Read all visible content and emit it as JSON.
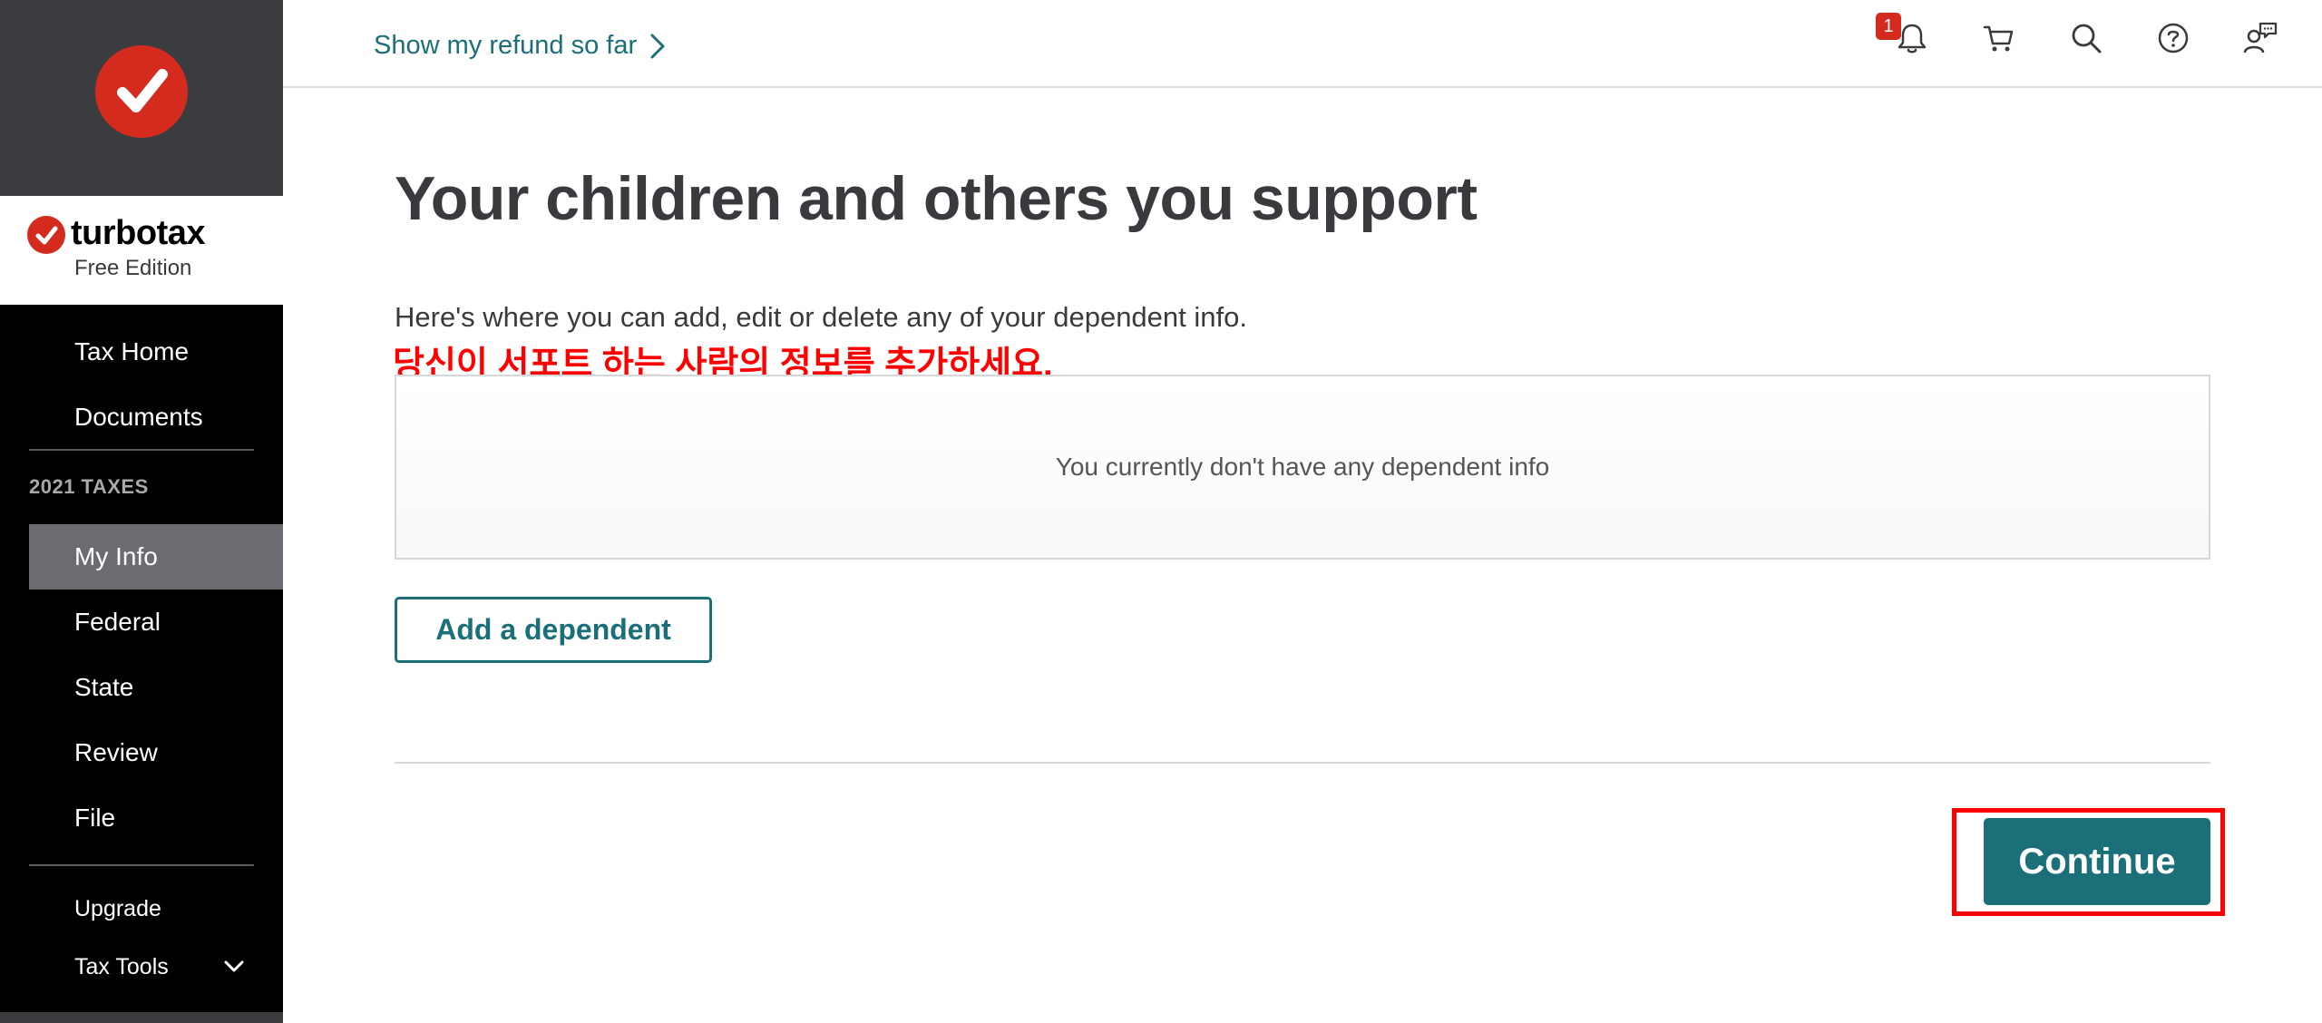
{
  "brand": {
    "name": "turbotax",
    "edition": "Free Edition"
  },
  "sidebar": {
    "items_top": [
      {
        "label": "Tax Home"
      },
      {
        "label": "Documents"
      }
    ],
    "section_label": "2021 TAXES",
    "items_taxes": [
      {
        "label": "My Info",
        "active": true
      },
      {
        "label": "Federal"
      },
      {
        "label": "State"
      },
      {
        "label": "Review"
      },
      {
        "label": "File"
      }
    ],
    "items_bottom": [
      {
        "label": "Upgrade"
      },
      {
        "label": "Tax Tools"
      }
    ]
  },
  "header": {
    "refund_link": "Show my refund so far",
    "notification_count": "1",
    "icons": [
      "bell-icon",
      "cart-icon",
      "search-icon",
      "help-icon",
      "chat-icon"
    ]
  },
  "main": {
    "title": "Your children and others you support",
    "intro": "Here's where you can add, edit or delete any of your dependent info.",
    "annotation": "당신이 서포트 하는 사람의 정보를 추가하세요.",
    "empty_message": "You currently don't have any dependent info",
    "add_button": "Add a dependent",
    "continue_button": "Continue"
  },
  "colors": {
    "brand_red": "#d52b1e",
    "teal": "#1a6f79",
    "annotation_red": "#ff0000"
  }
}
